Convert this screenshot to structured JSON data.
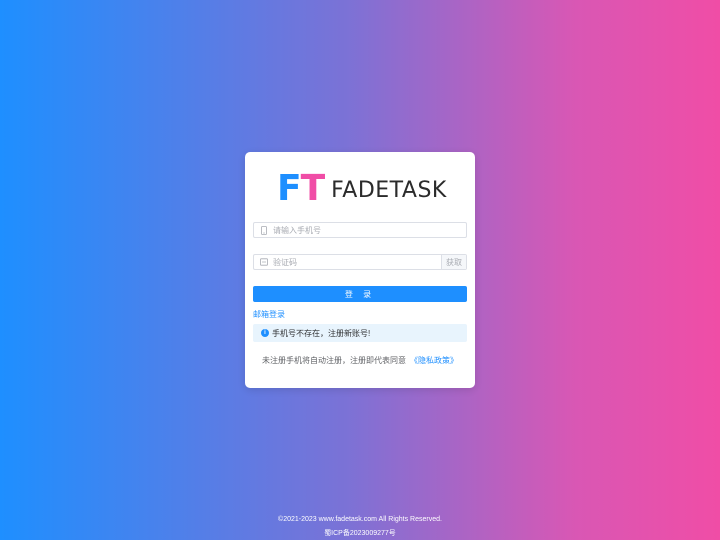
{
  "logo": {
    "mark_f": "F",
    "mark_t": "T",
    "text": "FADETASK"
  },
  "form": {
    "phone_placeholder": "请输入手机号",
    "code_placeholder": "验证码",
    "get_code_label": "获取",
    "login_label": "登 录",
    "email_login_label": "邮箱登录"
  },
  "alert": {
    "icon": "info-icon",
    "text": "手机号不存在，注册新账号!"
  },
  "notice": {
    "text": "未注册手机将自动注册，注册即代表同意",
    "policy_link": "《隐私政策》"
  },
  "footer": {
    "copyright": "©2021-2023 www.fadetask.com All Rights Reserved.",
    "icp": "蜀ICP备2023009277号"
  },
  "colors": {
    "primary": "#1e8fff",
    "brand_pink": "#f04da6",
    "alert_bg": "#e8f4fd"
  }
}
